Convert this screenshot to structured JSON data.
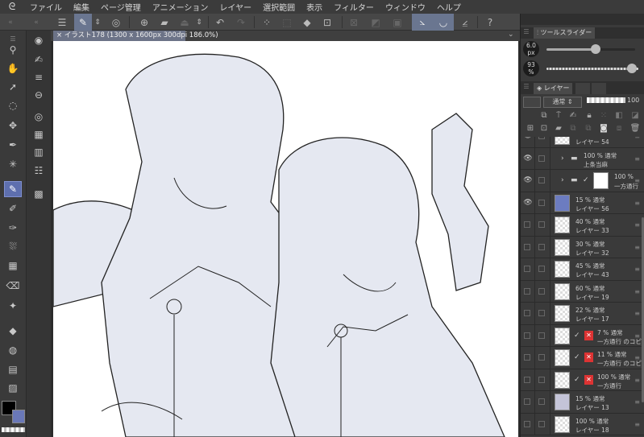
{
  "menu": [
    "ファイル",
    "編集",
    "ページ管理",
    "アニメーション",
    "レイヤー",
    "選択範囲",
    "表示",
    "フィルター",
    "ウィンドウ",
    "ヘルプ"
  ],
  "canvas_tab": "× イラスト178 (1300 x 1600px 300dpi 186.0%)",
  "tool_slider": {
    "title": "ツールスライダー",
    "size_value": "6.0",
    "size_unit": "px",
    "size_fraction": 0.55,
    "opacity_value": "93",
    "opacity_unit": "%",
    "opacity_fraction": 0.93
  },
  "layer_panel": {
    "tab": "レイヤー",
    "blend_mode": "通常",
    "opacity": "100"
  },
  "colors": {
    "accent": "#5e6fae",
    "main_color": "#000000",
    "sub_color": "#6a78b8"
  },
  "layers": [
    {
      "opacity": "",
      "name": "レイヤー 54",
      "visible": true,
      "type": "layer"
    },
    {
      "opacity": "100 % 通常",
      "name": "上条当麻",
      "visible": true,
      "type": "folder"
    },
    {
      "opacity": "100 %",
      "name": "一方通行",
      "visible": true,
      "type": "folder-mask"
    },
    {
      "opacity": "15 % 通常",
      "name": "レイヤー 56",
      "visible": true,
      "type": "layer",
      "thumb": "#6c7cc0"
    },
    {
      "opacity": "40 % 通常",
      "name": "レイヤー 33",
      "visible": false,
      "type": "layer"
    },
    {
      "opacity": "30 % 通常",
      "name": "レイヤー 32",
      "visible": false,
      "type": "layer"
    },
    {
      "opacity": "45 % 通常",
      "name": "レイヤー 43",
      "visible": false,
      "type": "layer"
    },
    {
      "opacity": "60 % 通常",
      "name": "レイヤー 19",
      "visible": false,
      "type": "layer"
    },
    {
      "opacity": "22 % 通常",
      "name": "レイヤー 17",
      "visible": false,
      "type": "layer"
    },
    {
      "opacity": "7 % 通常",
      "name": "一方通行 のコピー",
      "visible": false,
      "type": "masked"
    },
    {
      "opacity": "11 % 通常",
      "name": "一方通行 のコピー",
      "visible": false,
      "type": "masked"
    },
    {
      "opacity": "100 % 通常",
      "name": "一方通行",
      "visible": false,
      "type": "masked"
    },
    {
      "opacity": "15 % 通常",
      "name": "レイヤー 13",
      "visible": false,
      "type": "layer",
      "thumb": "#c4c4d8"
    },
    {
      "opacity": "100 % 通常",
      "name": "レイヤー 18",
      "visible": false,
      "type": "layer"
    }
  ]
}
